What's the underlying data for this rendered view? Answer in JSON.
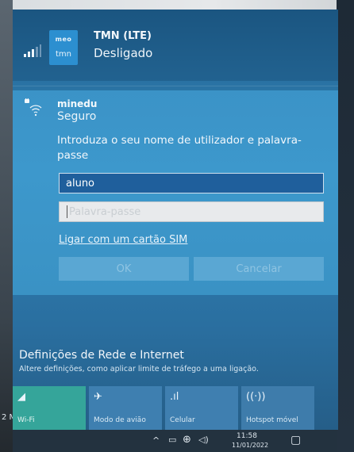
{
  "cellular": {
    "carrier_logo_top": "meo",
    "carrier_logo_bottom": "tmn",
    "name": "TMN (LTE)",
    "status": "Desligado"
  },
  "wifi": {
    "name": "minedu",
    "status": "Seguro",
    "prompt": "Introduza o seu nome de utilizador e palavra-passe",
    "username_value": "aluno",
    "password_placeholder": "Palavra-passe",
    "sim_link": "Ligar com um cartão SIM",
    "ok_label": "OK",
    "cancel_label": "Cancelar"
  },
  "settings": {
    "title": "Definições de Rede e Internet",
    "subtitle": "Altere definições, como aplicar limite de tráfego a uma ligação."
  },
  "tiles": [
    {
      "label": "Wi-Fi",
      "icon": "wifi-icon"
    },
    {
      "label": "Modo de avião",
      "icon": "airplane-icon"
    },
    {
      "label": "Celular",
      "icon": "cellular-icon"
    },
    {
      "label": "Hotspot móvel",
      "icon": "hotspot-icon"
    }
  ],
  "taskbar": {
    "time": "11:58",
    "date": "11/01/2022"
  },
  "left_edge_label": "2 M",
  "colors": {
    "panel": "#2a73a4",
    "selected_card": "#3b93c7",
    "wifi_tile_active": "#35a59a",
    "username_field": "#1f5f9c"
  }
}
